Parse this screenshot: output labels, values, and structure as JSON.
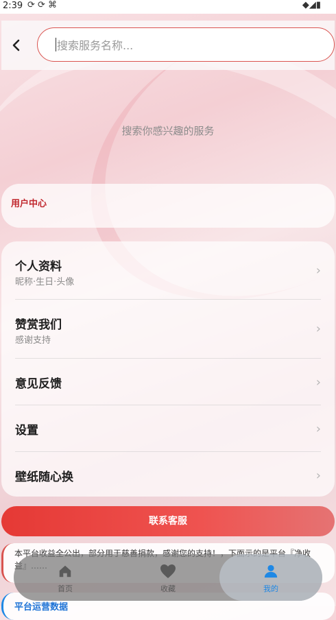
{
  "status_bar": {
    "time": "2:39",
    "left_icons": "⟳ ⟳ ⌘",
    "right_icons": "◆◢▮"
  },
  "search": {
    "back_icon": "chevron-left-icon",
    "placeholder": "搜索服务名称...",
    "hint": "搜索你感兴趣的服务"
  },
  "user_center": {
    "title": "用户中心"
  },
  "menu": {
    "items": [
      {
        "title": "个人资料",
        "subtitle": "昵称·生日·头像"
      },
      {
        "title": "赞赏我们",
        "subtitle": "感谢支持"
      },
      {
        "title": "意见反馈",
        "subtitle": ""
      },
      {
        "title": "设置",
        "subtitle": ""
      },
      {
        "title": "壁纸随心换",
        "subtitle": ""
      }
    ],
    "chevron": "›"
  },
  "contact": {
    "label": "联系客服"
  },
  "notice": {
    "text": "本平台收益全公出，部分用于慈善捐款，感谢您的支持！，下面示的是平台『净收益』……"
  },
  "stats": {
    "title": "平台运营数据"
  },
  "tab_bar": {
    "tabs": [
      {
        "label": "首页",
        "icon": "home-icon"
      },
      {
        "label": "收藏",
        "icon": "heart-icon"
      },
      {
        "label": "我的",
        "icon": "user-icon"
      }
    ],
    "active_color": "#1e88e5",
    "inactive_color": "#5a5a5a"
  },
  "colors": {
    "accent_red": "#e53935",
    "title_red": "#c0262d",
    "blue": "#1e73d6"
  }
}
